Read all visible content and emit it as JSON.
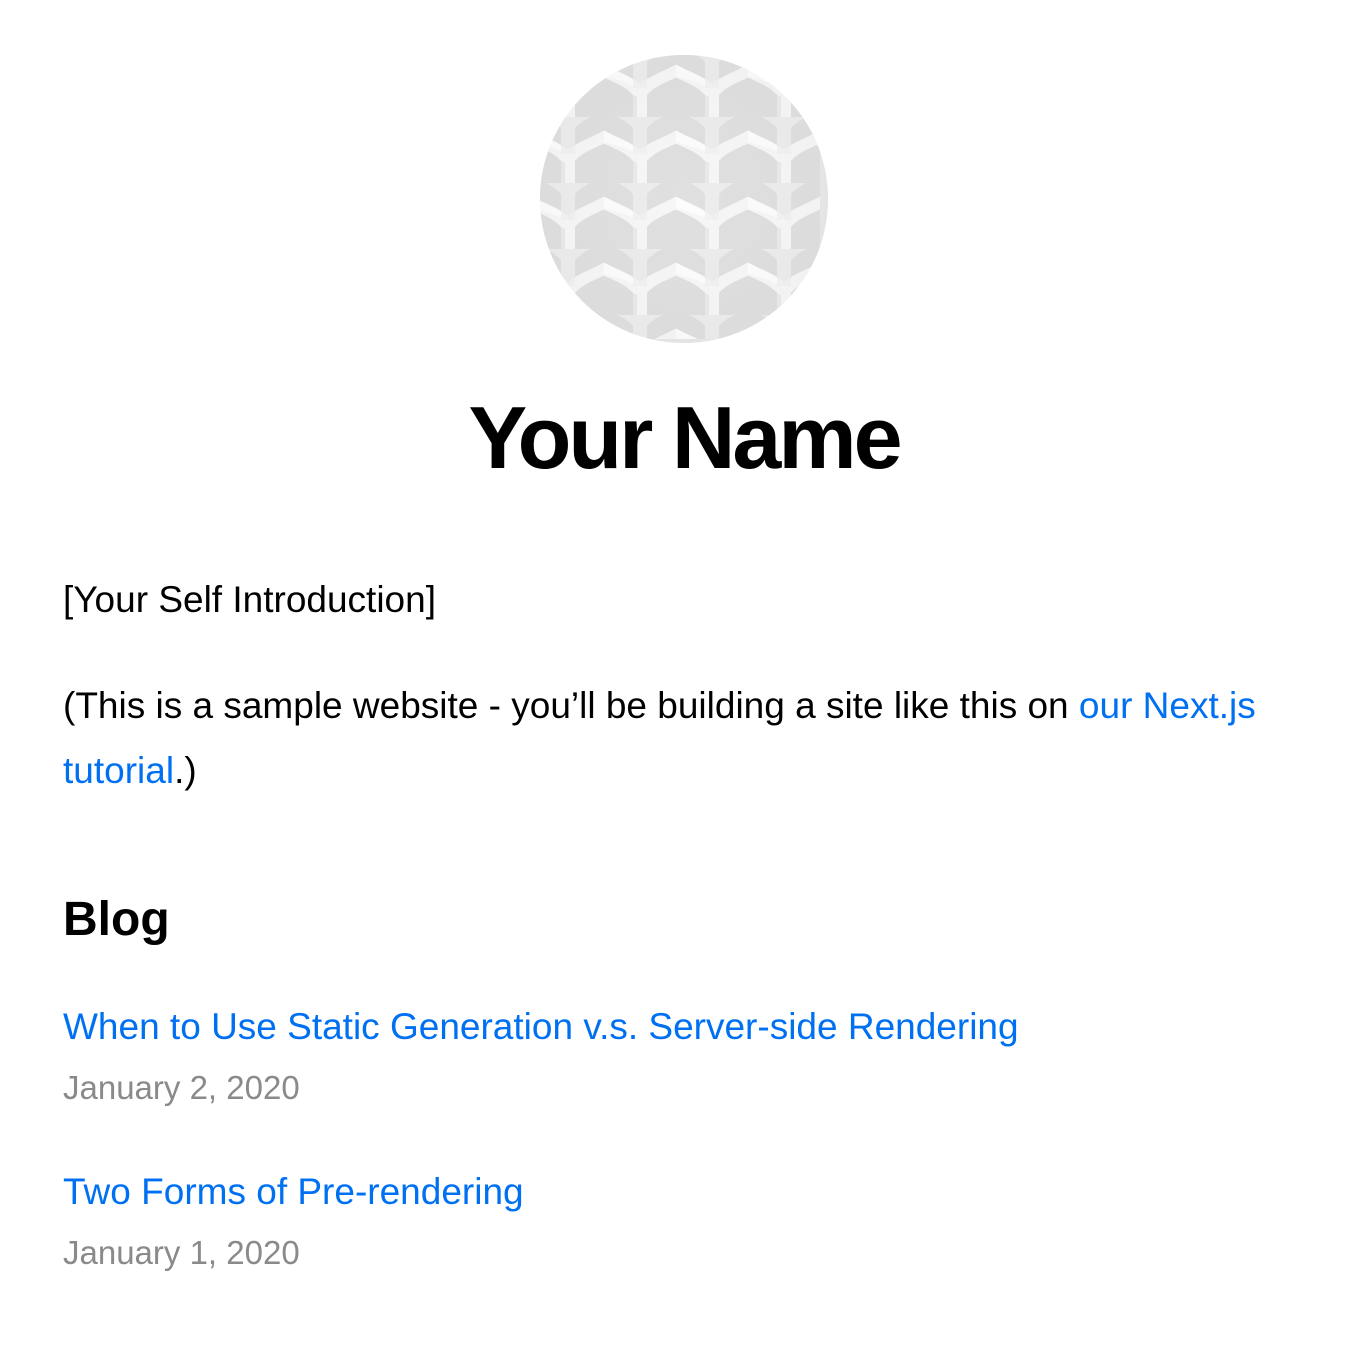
{
  "profile": {
    "name": "Your Name",
    "avatar_alt": "Your Name"
  },
  "intro": {
    "self_introduction": "[Your Self Introduction]",
    "note_prefix": "(This is a sample website - you’ll be building a site like this on ",
    "note_link": "our Next.js tutorial",
    "note_suffix": ".)"
  },
  "blog": {
    "heading": "Blog",
    "posts": [
      {
        "title": "When to Use Static Generation v.s. Server-side Rendering",
        "date": "January 2, 2020"
      },
      {
        "title": "Two Forms of Pre-rendering",
        "date": "January 1, 2020"
      }
    ]
  },
  "colors": {
    "link": "#0070f3",
    "date": "#8a8a8a",
    "text": "#000000"
  }
}
